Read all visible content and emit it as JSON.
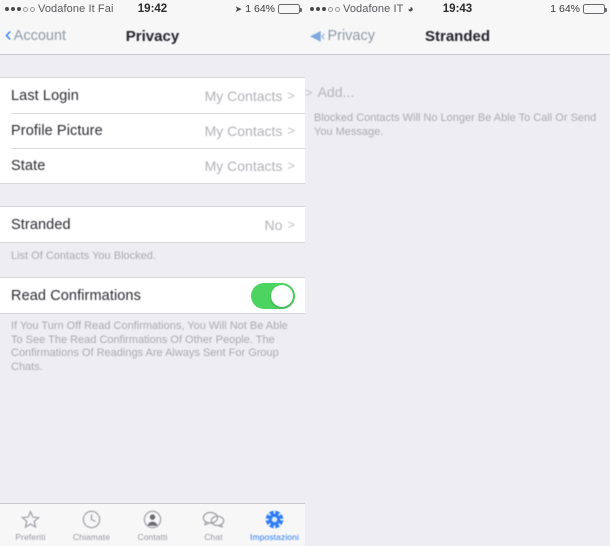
{
  "left_screen": {
    "status_bar": {
      "signal_dots_filled": 3,
      "signal_dots_hollow": 2,
      "carrier": "Vodafone It Fai",
      "time": "19:42",
      "battery_percent": "1 64%",
      "location_icon": "location-arrow-icon",
      "battery_icon": "battery-icon"
    },
    "nav": {
      "back_label": "Account",
      "back_icon": "chevron-left-icon",
      "title": "Privacy"
    },
    "group_one": [
      {
        "label": "Last Login",
        "value": "My Contacts",
        "chevron": ">"
      },
      {
        "label": "Profile Picture",
        "value": "My Contacts",
        "chevron": ">"
      },
      {
        "label": "State",
        "value": "My Contacts",
        "chevron": ">"
      }
    ],
    "group_two": {
      "row": {
        "label": "Stranded",
        "value": "No",
        "chevron": ">"
      },
      "footnote": "List Of Contacts You Blocked."
    },
    "group_three": {
      "row": {
        "label": "Read Confirmations",
        "toggle_on": true
      },
      "footnote": "If You Turn Off Read Confirmations, You Will Not Be Able To See The Read Confirmations Of Other People. The Confirmations Of Readings Are Always Sent For Group Chats."
    },
    "tabbar": [
      {
        "label": "Preferiti",
        "icon": "star-icon",
        "active": false
      },
      {
        "label": "Chiamate",
        "icon": "clock-icon",
        "active": false
      },
      {
        "label": "Contatti",
        "icon": "person-icon",
        "active": false
      },
      {
        "label": "Chat",
        "icon": "chat-bubbles-icon",
        "active": false
      },
      {
        "label": "Impostazioni",
        "icon": "gear-icon",
        "active": true
      }
    ]
  },
  "right_screen": {
    "status_bar": {
      "signal_dots_filled": 3,
      "signal_dots_hollow": 2,
      "carrier": "Vodafone IT",
      "wifi_icon": "wifi-icon",
      "time": "19:43",
      "battery_percent": "1 64%",
      "battery_icon": "battery-icon"
    },
    "nav": {
      "back_label": "Privacy",
      "back_icon": "chevron-left-icon",
      "title": "Stranded"
    },
    "add_row": {
      "chevron": ">",
      "label": "Add..."
    },
    "footnote": "Blocked Contacts Will No Longer Be Able To Call Or Send You Message."
  },
  "colors": {
    "accent_blue": "#2d7cf6",
    "toggle_green": "#4bd45f",
    "background_gray": "#eeeef2",
    "row_white": "#ffffff",
    "muted_text": "#b2b2b8"
  }
}
